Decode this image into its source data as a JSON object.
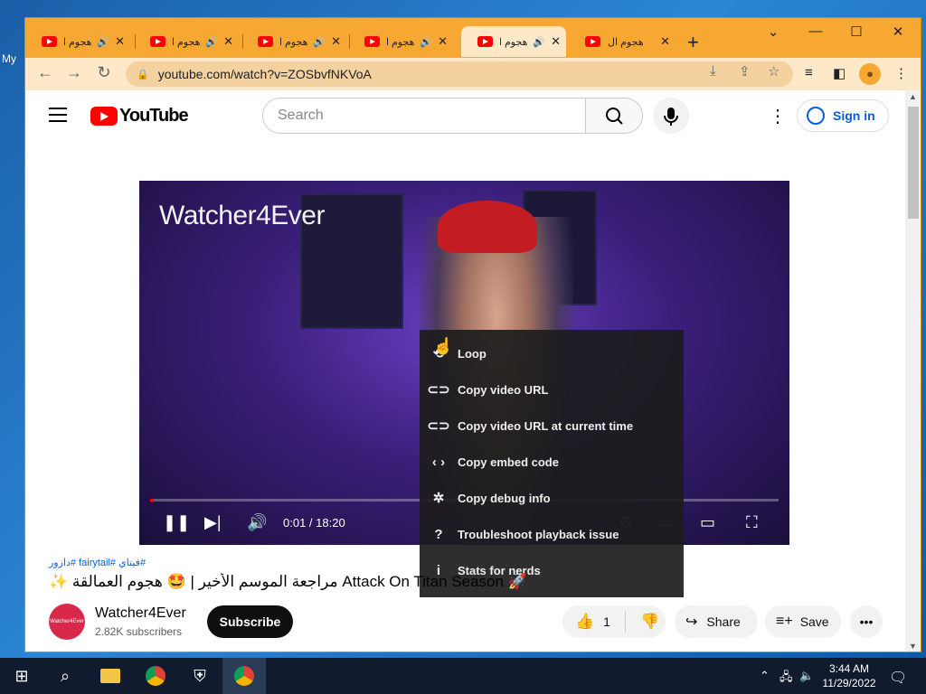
{
  "desktop": {
    "label": "My"
  },
  "browser": {
    "tabs": [
      {
        "title": "هجوم ال",
        "active": false
      },
      {
        "title": "هجوم ال",
        "active": false
      },
      {
        "title": "هجوم ال",
        "active": false
      },
      {
        "title": "هجوم ال",
        "active": false
      },
      {
        "title": "هجوم ال",
        "active": true
      },
      {
        "title": "هجوم ال",
        "active": false
      }
    ],
    "new_tab": "+",
    "url": "youtube.com/watch?v=ZOSbvfNKVoA",
    "window_controls": {
      "chevron": "⌄",
      "minimize": "—",
      "maximize": "☐",
      "close": "✕"
    }
  },
  "youtube": {
    "logo_text": "YouTube",
    "search_placeholder": "Search",
    "sign_in": "Sign in",
    "player": {
      "watermark": "Watcher4Ever",
      "time": "0:01 / 18:20",
      "progress": 0.001
    },
    "context_menu": [
      {
        "icon": "loop-icon",
        "glyph": "⟲",
        "label": "Loop"
      },
      {
        "icon": "link-icon",
        "glyph": "⊂⊃",
        "label": "Copy video URL"
      },
      {
        "icon": "link-icon",
        "glyph": "⊂⊃",
        "label": "Copy video URL at current time"
      },
      {
        "icon": "code-icon",
        "glyph": "‹ ›",
        "label": "Copy embed code"
      },
      {
        "icon": "bug-icon",
        "glyph": "✲",
        "label": "Copy debug info"
      },
      {
        "icon": "help-icon",
        "glyph": "?",
        "label": "Troubleshoot playback issue"
      },
      {
        "icon": "info-icon",
        "glyph": "i",
        "label": "Stats for nerds"
      }
    ],
    "hashtags": "#فيتاي #fairytail #دازور",
    "title": "✨ مراجعة الموسم الأخير | 🤩 هجوم العمالقة Attack On Titan Season 🚀",
    "channel": {
      "name": "Watcher4Ever",
      "subscribers": "2.82K subscribers",
      "avatar_text": "Watcher4Ever"
    },
    "subscribe_label": "Subscribe",
    "likes": "1",
    "share_label": "Share",
    "save_label": "Save"
  },
  "taskbar": {
    "time": "3:44 AM",
    "date": "11/29/2022"
  }
}
